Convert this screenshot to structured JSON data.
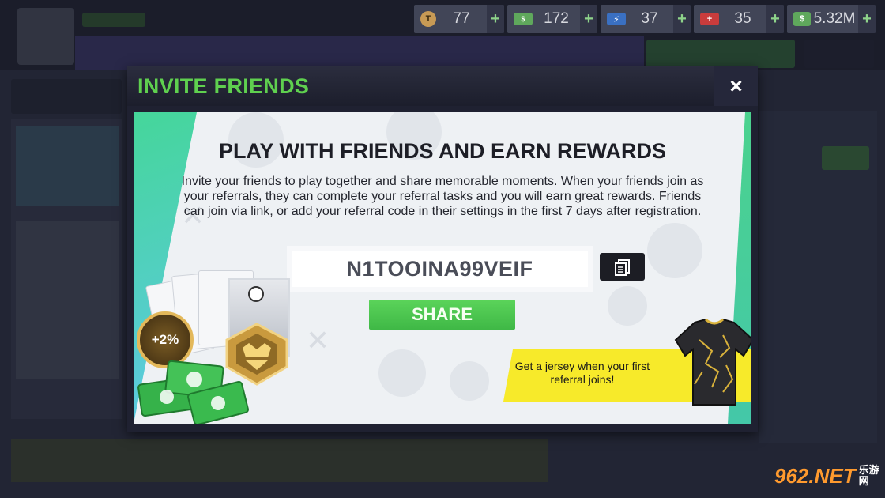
{
  "currencies": [
    {
      "name": "token",
      "icon": "token-coin-icon",
      "value": "77"
    },
    {
      "name": "cash",
      "icon": "cash-note-icon",
      "value": "172"
    },
    {
      "name": "energy",
      "icon": "energy-bolt-icon",
      "value": "37"
    },
    {
      "name": "medic",
      "icon": "medic-kit-icon",
      "value": "35"
    },
    {
      "name": "money",
      "icon": "money-bill-icon",
      "value": "5.32M"
    }
  ],
  "currency_add_label": "+",
  "modal": {
    "title": "INVITE FRIENDS",
    "close_label": "×",
    "headline": "PLAY WITH FRIENDS AND EARN REWARDS",
    "description": "Invite your friends to play together and share memorable moments. When your friends join as your referrals, they can complete your referral tasks and you will earn great rewards. Friends can join via link, or add your referral code in their settings in the first 7 days after registration.",
    "referral_code": "N1TOOINA99VEIF",
    "share_label": "SHARE",
    "boost_label": "+2%",
    "jersey_reward_text": "Get a jersey when your first referral joins!"
  },
  "watermark": {
    "main": "962.NET",
    "sub": "乐游网"
  },
  "colors": {
    "title_green": "#5fd04f",
    "share_green": "#4cc84f",
    "banner_yellow": "#f7ea2a",
    "modal_dark": "#1f2131"
  }
}
